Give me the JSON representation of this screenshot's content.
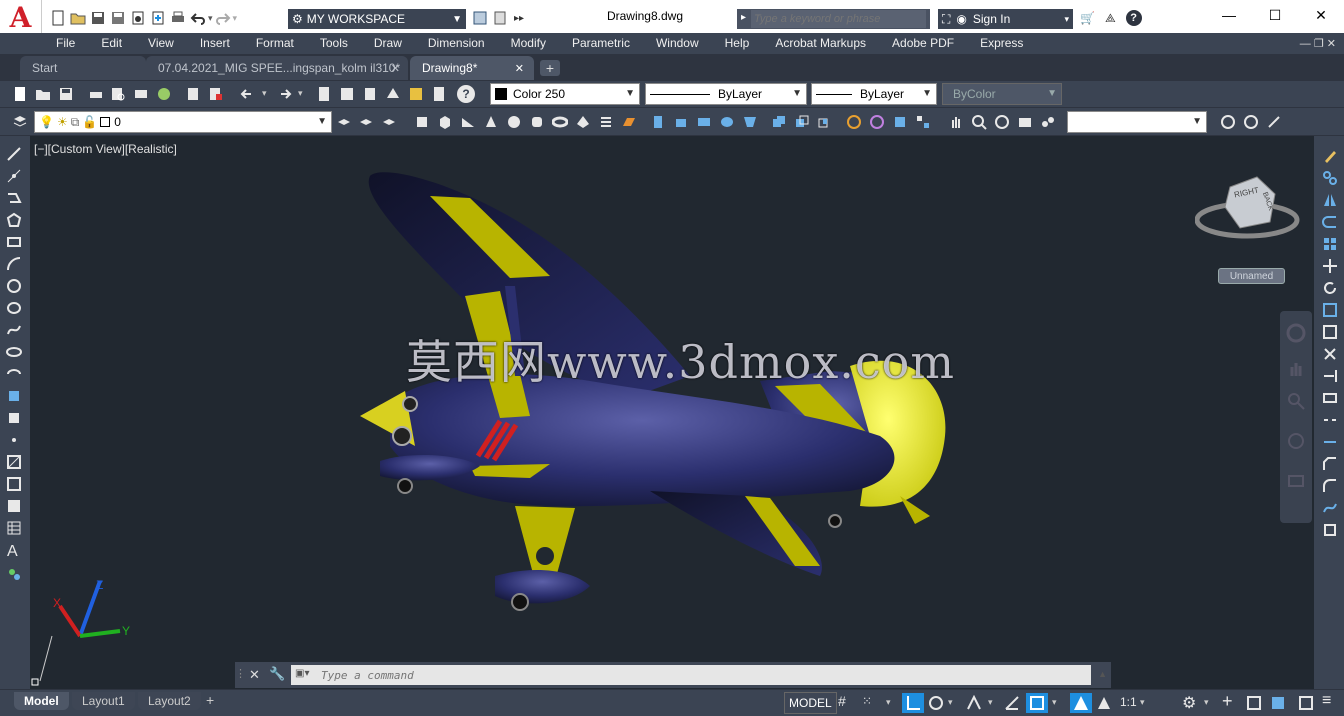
{
  "titlebar": {
    "workspace": "MY WORKSPACE",
    "document_title": "Drawing8.dwg",
    "search_placeholder": "Type a keyword or phrase",
    "sign_in": "Sign In"
  },
  "menubar": {
    "items": [
      "File",
      "Edit",
      "View",
      "Insert",
      "Format",
      "Tools",
      "Draw",
      "Dimension",
      "Modify",
      "Parametric",
      "Window",
      "Help",
      "Acrobat Markups",
      "Adobe PDF",
      "Express"
    ]
  },
  "file_tabs": [
    {
      "label": "Start"
    },
    {
      "label": "07.04.2021_MIG SPEE...ingspan_kolm il310*"
    },
    {
      "label": "Drawing8*"
    }
  ],
  "properties": {
    "color": "Color 250",
    "linetype": "ByLayer",
    "lineweight": "ByLayer",
    "plotstyle": "ByColor"
  },
  "layer": {
    "current": "0"
  },
  "viewport": {
    "label": "[−][Custom View][Realistic]",
    "viewcube_right": "RIGHT",
    "viewcube_back": "BACK",
    "viewcube_ucs": "Unnamed",
    "watermark": "莫西网www.3dmox.com",
    "axis_x": "X",
    "axis_y": "Y",
    "axis_z": "Z"
  },
  "commandline": {
    "placeholder": "Type a command"
  },
  "status": {
    "layout_tabs": [
      "Model",
      "Layout1",
      "Layout2"
    ],
    "model_button": "MODEL",
    "scale": "1:1"
  },
  "colors": {
    "accent": "#1e8fe0",
    "logo_red": "#d0202a",
    "fuselage": "#2b2f6e",
    "wing_yellow": "#b8b400",
    "tail_yellow": "#e8e83a"
  }
}
